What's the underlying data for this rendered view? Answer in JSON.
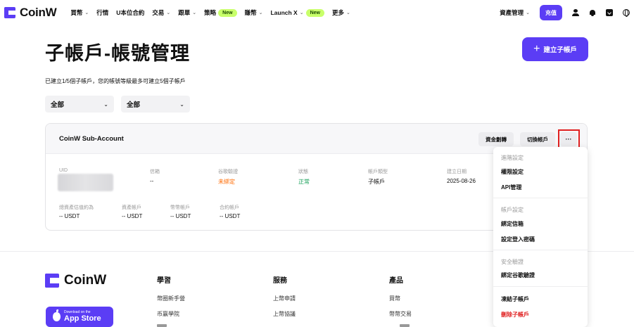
{
  "brand": {
    "name": "CoinW",
    "accent": "#5b3df5",
    "warn": "#ff6a00",
    "ok": "#19a05a",
    "danger": "#e02020"
  },
  "header": {
    "menu": [
      {
        "label": "買幣",
        "chevron": true
      },
      {
        "label": "行情",
        "chevron": false
      },
      {
        "label": "U本位合約",
        "chevron": false
      },
      {
        "label": "交易",
        "chevron": true
      },
      {
        "label": "跟單",
        "chevron": true
      },
      {
        "label": "策略",
        "badge": "New",
        "chevron": false
      },
      {
        "label": "賺幣",
        "chevron": true
      },
      {
        "label": "Launch X",
        "badge": "New",
        "chevron": true
      },
      {
        "label": "更多",
        "chevron": true
      }
    ],
    "asset_management": "資產管理",
    "deposit": "充值",
    "icons": [
      "user-icon",
      "bell-icon",
      "download-icon",
      "globe-icon"
    ]
  },
  "page": {
    "title": "子帳戶-帳號管理",
    "create_button": "建立子帳戶",
    "info": "已建立1/5個子帳戶，您的帳號等級最多可建立5個子帳戶",
    "filter1": "全部",
    "filter2": "全部"
  },
  "account": {
    "name": "CoinW Sub-Account",
    "transfer": "資金劃轉",
    "switch": "切換帳戶",
    "more": "···",
    "fields": [
      {
        "label": "UID",
        "value": ""
      },
      {
        "label": "信箱",
        "value": "--"
      },
      {
        "label": "谷歌驗證",
        "value": "未綁定"
      },
      {
        "label": "狀態",
        "value": "正常"
      },
      {
        "label": "帳戶類型",
        "value": "子帳戶"
      },
      {
        "label": "建立日期",
        "value": "2025-08-26"
      }
    ],
    "balances": [
      {
        "label": "總資產估值約為",
        "value": "-- USDT"
      },
      {
        "label": "資產帳戶",
        "value": "-- USDT"
      },
      {
        "label": "幣幣帳戶",
        "value": "-- USDT"
      },
      {
        "label": "合約帳戶",
        "value": "-- USDT"
      }
    ]
  },
  "dropdown": {
    "advanced": "進階設定",
    "permissions": "權限設定",
    "api": "API管理",
    "account_settings": "帳戶設定",
    "bind_email": "綁定信箱",
    "set_password": "設定登入密碼",
    "security": "安全驗證",
    "bind_google": "綁定谷歌驗證",
    "freeze": "凍結子帳戶",
    "delete": "刪除子帳戶"
  },
  "footer": {
    "brand": "CoinW",
    "appstore_small": "Download on the",
    "appstore_big": "App Store",
    "learn": {
      "title": "學習",
      "links": [
        "幣圈新手營",
        "币赢學院"
      ]
    },
    "service": {
      "title": "服務",
      "links": [
        "上幣申請",
        "上幣協議"
      ]
    },
    "products": {
      "title": "產品",
      "links": [
        "買幣",
        "幣幣交易"
      ]
    }
  }
}
